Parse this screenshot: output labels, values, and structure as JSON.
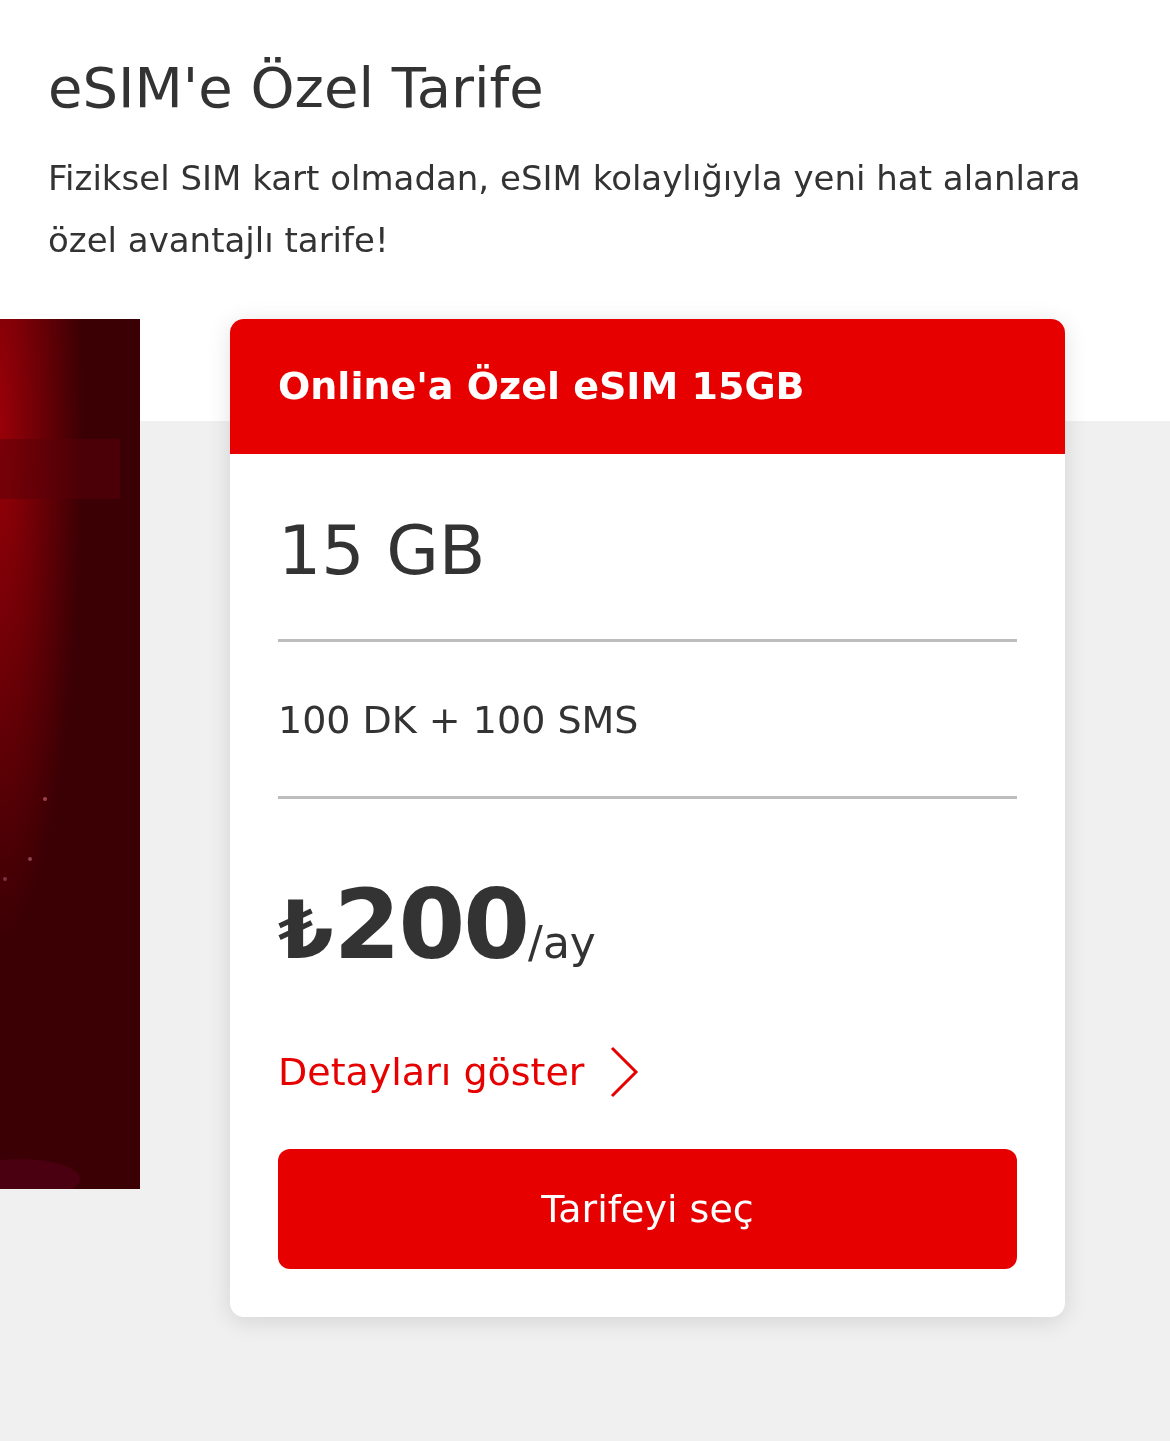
{
  "title": "eSIM'e Özel Tarife",
  "description": "Fiziksel SIM kart olmadan, eSIM kolaylığıyla yeni hat alanlara özel avantajlı tarife!",
  "tariff_card": {
    "header": "Online'a Özel eSIM 15GB",
    "data": "15 GB",
    "minutes_sms": "100 DK + 100 SMS",
    "price": {
      "currency": "₺",
      "amount": "200",
      "period": "/ay"
    },
    "details_link": "Detayları göster",
    "select_button": "Tarifeyi seç"
  }
}
